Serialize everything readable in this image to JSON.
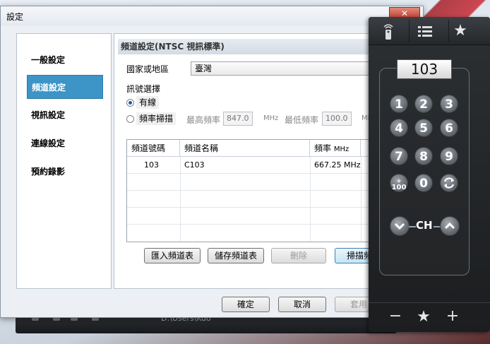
{
  "window": {
    "title": "設定",
    "close_glyph": "✕"
  },
  "nav": {
    "items": [
      {
        "label": "一般設定"
      },
      {
        "label": "頻道設定"
      },
      {
        "label": "視訊設定"
      },
      {
        "label": "連線設定"
      },
      {
        "label": "預約錄影"
      }
    ],
    "active_index": 1
  },
  "panel": {
    "heading": "頻道設定(NTSC 視訊標準)",
    "country_label": "國家或地區",
    "country_value": "臺灣",
    "signal_label": "訊號選擇",
    "radio_cable": "有線",
    "radio_scan": "頻率掃描",
    "max_freq_label": "最高頻率",
    "max_freq_value": "847.0",
    "max_freq_unit": "MHz",
    "min_freq_label": "最低頻率",
    "min_freq_value": "100.0",
    "min_freq_unit": "MH"
  },
  "table": {
    "headers": {
      "channel_no": "頻道號碼",
      "channel_name": "頻道名稱",
      "freq": "頻率",
      "freq_unit": "MHz"
    },
    "rows": [
      {
        "no": "103",
        "name": "C103",
        "freq": "667.25 MHz"
      }
    ]
  },
  "buttons": {
    "import": "匯入頻道表",
    "save": "儲存頻道表",
    "delete": "刪除",
    "scan": "掃描頻",
    "ok": "確定",
    "cancel": "取消",
    "apply": "套用"
  },
  "remote": {
    "channel_display": "103",
    "keys": [
      "1",
      "2",
      "3",
      "4",
      "5",
      "6",
      "7",
      "8",
      "9"
    ],
    "key_100": "100",
    "key_0": "0",
    "ch_label": "CH",
    "tab_icons": [
      "remote-icon",
      "list-icon",
      "star-icon"
    ],
    "bottom_icons": [
      "minus-icon",
      "star-icon",
      "plus-icon"
    ]
  },
  "taskbar": {
    "text": "D:\\Users\\Kuo"
  },
  "colors": {
    "accent": "#3c94c7",
    "remote_bg": "#1b1d1f"
  }
}
